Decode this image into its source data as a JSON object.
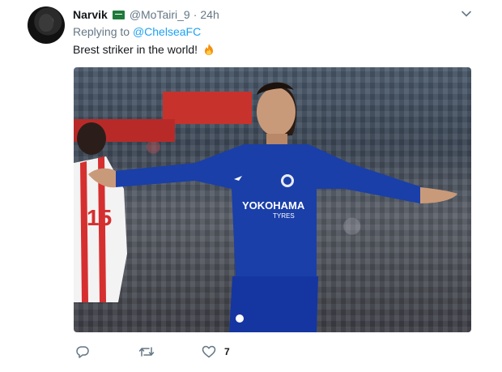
{
  "tweet": {
    "author_name": "Narvik",
    "handle": "@MoTairi_9",
    "separator": "·",
    "time": "24h",
    "replying_to_prefix": "Replying to",
    "replying_to_link": "@ChelseaFC",
    "text": "Brest striker in the world!",
    "jersey": {
      "number": "15",
      "sponsor": "YOKOHAMA",
      "sponsor_sub": "TYRES"
    },
    "actions": {
      "reply": {
        "icon": "reply-icon"
      },
      "retweet": {
        "icon": "retweet-icon"
      },
      "like": {
        "icon": "heart-icon",
        "count": "7"
      }
    }
  },
  "colors": {
    "link": "#1da1f2",
    "muted": "#657786",
    "text": "#14171a",
    "chelsea_blue": "#1a3fa8"
  },
  "icons": {
    "flag": "saudi-flag-icon",
    "menu": "chevron-down-icon",
    "emoji": "fire-icon"
  }
}
